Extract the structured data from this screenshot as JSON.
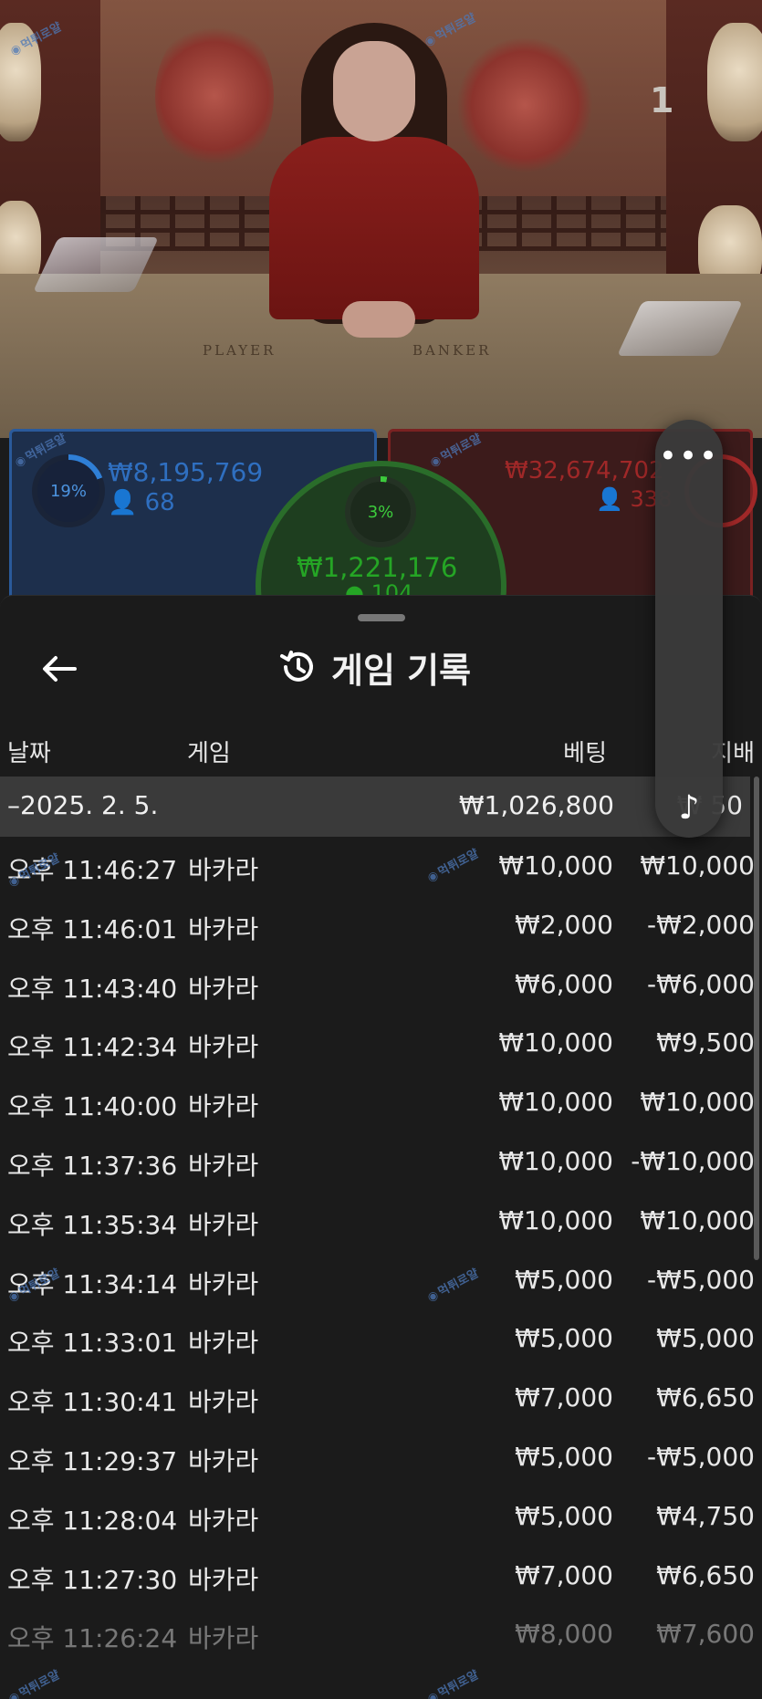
{
  "video": {
    "table_number": "1",
    "table_labels": {
      "player": "PLAYER",
      "banker": "BANKER"
    },
    "watermark": "먹튀로얄"
  },
  "bets": {
    "player": {
      "percent": "19%",
      "amount": "₩8,195,769",
      "players": "68",
      "color": "#2f6fc0"
    },
    "banker": {
      "amount": "₩32,674,702",
      "players": "338",
      "color": "#a02828"
    },
    "tie": {
      "percent": "3%",
      "amount": "₩1,221,176",
      "players": "104",
      "color": "#25a525"
    }
  },
  "history": {
    "title": "게임 기록",
    "back_icon": "arrow-left-icon",
    "title_icon": "history-icon",
    "columns": {
      "date": "날짜",
      "game": "게임",
      "bet": "베팅",
      "payout": "지배"
    },
    "date_group": {
      "label": "–2025. 2. 5.",
      "bet_total": "₩1,026,800",
      "payout_total": "₩ 50"
    },
    "rows": [
      {
        "time": "오후 11:46:27",
        "game": "바카라",
        "bet": "₩10,000",
        "payout": "₩10,000"
      },
      {
        "time": "오후 11:46:01",
        "game": "바카라",
        "bet": "₩2,000",
        "payout": "-₩2,000"
      },
      {
        "time": "오후 11:43:40",
        "game": "바카라",
        "bet": "₩6,000",
        "payout": "-₩6,000"
      },
      {
        "time": "오후 11:42:34",
        "game": "바카라",
        "bet": "₩10,000",
        "payout": "₩9,500"
      },
      {
        "time": "오후 11:40:00",
        "game": "바카라",
        "bet": "₩10,000",
        "payout": "₩10,000"
      },
      {
        "time": "오후 11:37:36",
        "game": "바카라",
        "bet": "₩10,000",
        "payout": "-₩10,000"
      },
      {
        "time": "오후 11:35:34",
        "game": "바카라",
        "bet": "₩10,000",
        "payout": "₩10,000"
      },
      {
        "time": "오후 11:34:14",
        "game": "바카라",
        "bet": "₩5,000",
        "payout": "-₩5,000"
      },
      {
        "time": "오후 11:33:01",
        "game": "바카라",
        "bet": "₩5,000",
        "payout": "₩5,000"
      },
      {
        "time": "오후 11:30:41",
        "game": "바카라",
        "bet": "₩7,000",
        "payout": "₩6,650"
      },
      {
        "time": "오후 11:29:37",
        "game": "바카라",
        "bet": "₩5,000",
        "payout": "-₩5,000"
      },
      {
        "time": "오후 11:28:04",
        "game": "바카라",
        "bet": "₩5,000",
        "payout": "₩4,750"
      },
      {
        "time": "오후 11:27:30",
        "game": "바카라",
        "bet": "₩7,000",
        "payout": "₩6,650"
      },
      {
        "time": "오후 11:26:24",
        "game": "바카라",
        "bet": "₩8,000",
        "payout": "₩7,600"
      }
    ]
  },
  "float_menu": {
    "more_label": "•••",
    "more_icon": "more-dots-icon",
    "music_icon": "music-note-icon",
    "music_label": "♪"
  }
}
